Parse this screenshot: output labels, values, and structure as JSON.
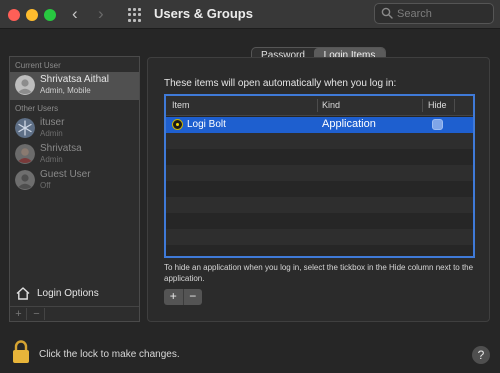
{
  "window": {
    "title": "Users & Groups",
    "search": {
      "placeholder": "Search",
      "value": ""
    }
  },
  "nav": {
    "back": "‹",
    "forward": "›"
  },
  "sidebar": {
    "current_user_label": "Current User",
    "other_users_label": "Other Users",
    "current_user": {
      "name": "Shrivatsa Aithal",
      "role": "Admin, Mobile"
    },
    "other_users": [
      {
        "name": "ituser",
        "role": "Admin"
      },
      {
        "name": "Shrivatsa",
        "role": "Admin"
      },
      {
        "name": "Guest User",
        "role": "Off"
      }
    ],
    "login_options_label": "Login Options",
    "footer": {
      "add": "+",
      "remove": "−"
    }
  },
  "tabs": {
    "password": "Password",
    "login_items": "Login Items",
    "selected": "login_items"
  },
  "login_items": {
    "heading": "These items will open automatically when you log in:",
    "columns": {
      "item": "Item",
      "kind": "Kind",
      "hide": "Hide"
    },
    "rows": [
      {
        "name": "Logi Bolt",
        "kind": "Application",
        "hide": false,
        "selected": true
      }
    ],
    "hint": "To hide an application when you log in, select the tickbox in the Hide column next to the application.",
    "add": "+",
    "remove": "−"
  },
  "lock": {
    "text": "Click the lock to make changes."
  },
  "help": {
    "label": "?"
  },
  "colors": {
    "accent": "#1e5fcf",
    "focus_ring": "#3f7ad8",
    "lock": "#e8b53a"
  }
}
